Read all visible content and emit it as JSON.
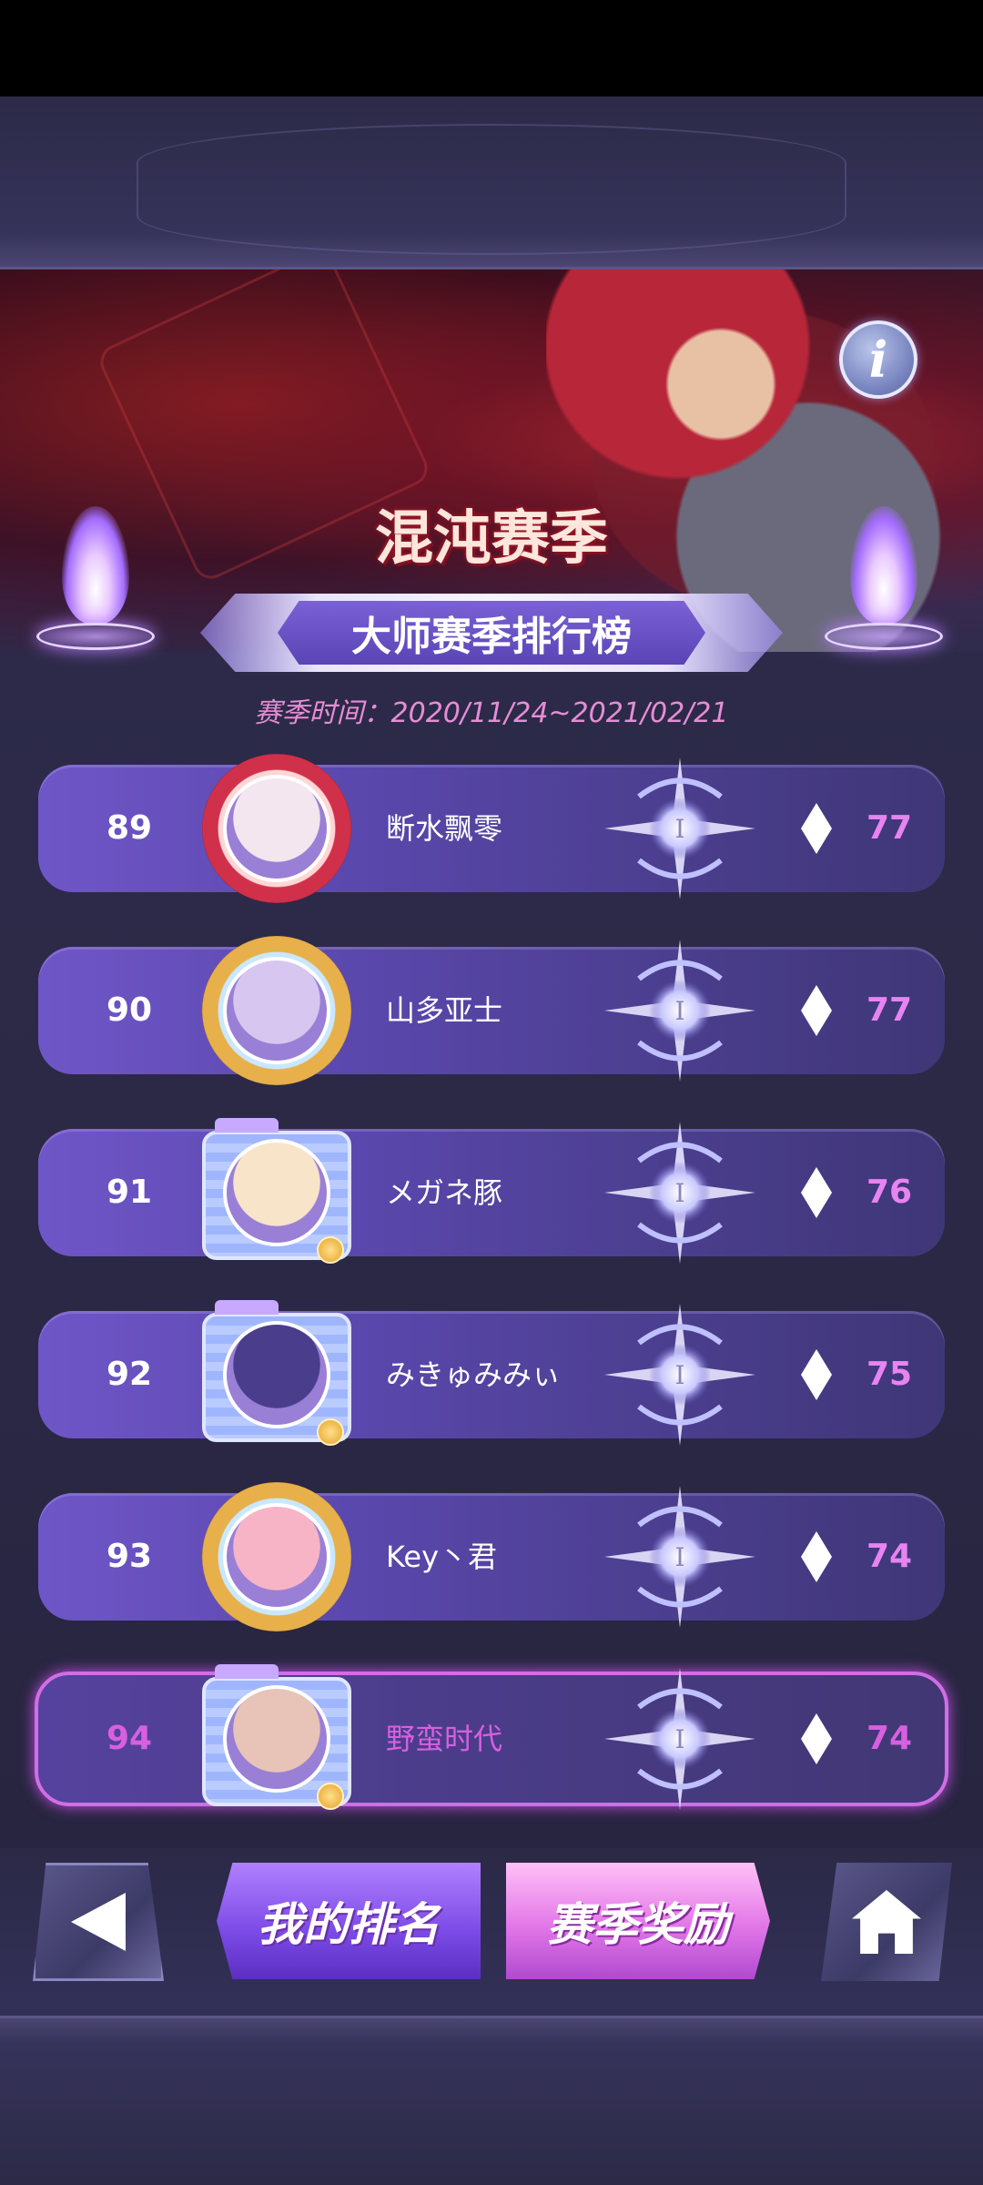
{
  "banner": {
    "season_title": "混沌赛季",
    "subtitle": "大师赛季排行榜",
    "season_time": "赛季时间：2020/11/24~2021/02/21",
    "info_label": "i"
  },
  "leaderboard": {
    "rows": [
      {
        "rank": "89",
        "name": "断水飘零",
        "points": "77",
        "avatar_style": "round-red",
        "mine": false
      },
      {
        "rank": "90",
        "name": "山多亚士",
        "points": "77",
        "avatar_style": "winged-gold",
        "mine": false
      },
      {
        "rank": "91",
        "name": "メガネ豚",
        "points": "76",
        "avatar_style": "camera",
        "mine": false
      },
      {
        "rank": "92",
        "name": "みきゅみみぃ",
        "points": "75",
        "avatar_style": "camera",
        "mine": false
      },
      {
        "rank": "93",
        "name": "Key丶君",
        "points": "74",
        "avatar_style": "winged-gold",
        "mine": false
      },
      {
        "rank": "94",
        "name": "野蛮时代",
        "points": "74",
        "avatar_style": "camera",
        "mine": true
      }
    ],
    "emblem_label": "I"
  },
  "buttons": {
    "my_rank": "我的排名",
    "season_rewards": "赛季奖励",
    "back_icon": "back-arrow-icon",
    "home_icon": "home-icon"
  },
  "colors": {
    "accent_pink": "#d760e0",
    "row_purple": "#5a48ad",
    "title_text": "#fde6dc"
  }
}
